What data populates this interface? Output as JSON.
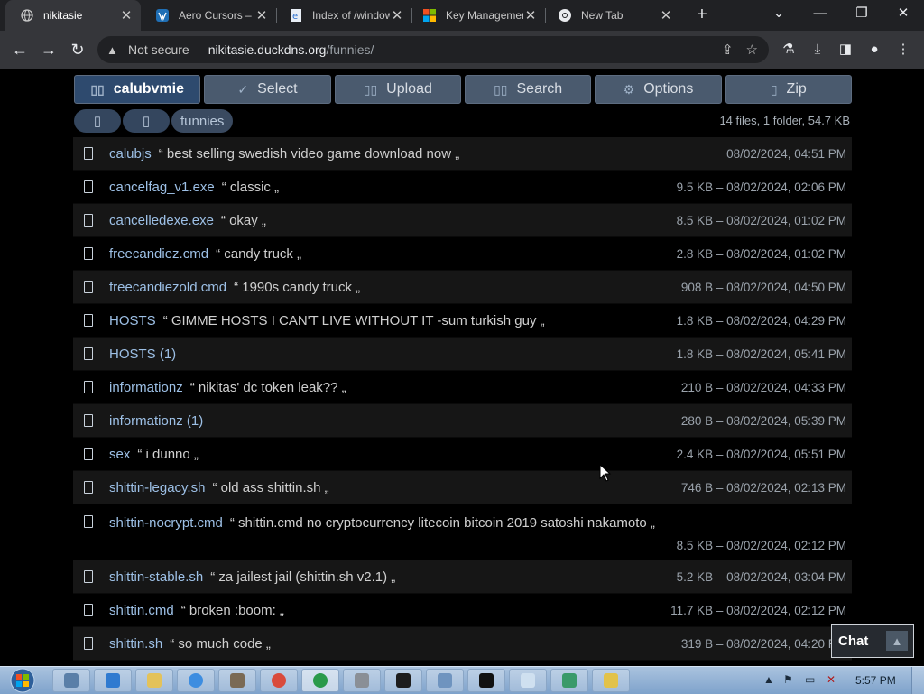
{
  "browser": {
    "tabs": [
      {
        "title": "nikitasie",
        "active": true
      },
      {
        "title": "Aero Cursors – W",
        "active": false
      },
      {
        "title": "Index of /window",
        "active": false
      },
      {
        "title": "Key Managemen",
        "active": false
      },
      {
        "title": "New Tab",
        "active": false
      }
    ],
    "address": {
      "security": "Not secure",
      "host": "nikitasie.duckdns.org",
      "path": "/funnies/"
    }
  },
  "toolbar": {
    "user": "calubvmie",
    "select": "Select",
    "upload": "Upload",
    "search": "Search",
    "options": "Options",
    "zip": "Zip"
  },
  "breadcrumb": {
    "folder": "funnies",
    "summary": "14 files, 1 folder, 54.7 KB"
  },
  "files": [
    {
      "name": "calubjs",
      "desc": "“ best selling swedish video game download now „",
      "meta": "08/02/2024, 04:51 PM"
    },
    {
      "name": "cancelfag_v1.exe",
      "desc": "“ classic „",
      "meta": "9.5 KB – 08/02/2024, 02:06 PM"
    },
    {
      "name": "cancelledexe.exe",
      "desc": "“ okay „",
      "meta": "8.5 KB – 08/02/2024, 01:02 PM"
    },
    {
      "name": "freecandiez.cmd",
      "desc": "“ candy truck „",
      "meta": "2.8 KB – 08/02/2024, 01:02 PM"
    },
    {
      "name": "freecandiezold.cmd",
      "desc": "“ 1990s candy truck „",
      "meta": "908 B – 08/02/2024, 04:50 PM"
    },
    {
      "name": "HOSTS",
      "desc": "“ GIMME HOSTS I CAN'T LIVE WITHOUT IT -sum turkish guy „",
      "meta": "1.8 KB – 08/02/2024, 04:29 PM"
    },
    {
      "name": "HOSTS (1)",
      "desc": "",
      "meta": "1.8 KB – 08/02/2024, 05:41 PM"
    },
    {
      "name": "informationz",
      "desc": "“ nikitas' dc token leak?? „",
      "meta": "210 B – 08/02/2024, 04:33 PM"
    },
    {
      "name": "informationz (1)",
      "desc": "",
      "meta": "280 B – 08/02/2024, 05:39 PM"
    },
    {
      "name": "sex",
      "desc": "“ i dunno „",
      "meta": "2.4 KB – 08/02/2024, 05:51 PM"
    },
    {
      "name": "shittin-legacy.sh",
      "desc": "“ old ass shittin.sh „",
      "meta": "746 B – 08/02/2024, 02:13 PM"
    },
    {
      "name": "shittin-nocrypt.cmd",
      "desc": "“ shittin.cmd no cryptocurrency litecoin bitcoin 2019 satoshi nakamoto „",
      "meta": "8.5 KB – 08/02/2024, 02:12 PM"
    },
    {
      "name": "shittin-stable.sh",
      "desc": "“ za jailest jail (shittin.sh v2.1) „",
      "meta": "5.2 KB – 08/02/2024, 03:04 PM"
    },
    {
      "name": "shittin.cmd",
      "desc": "“ broken :boom: „",
      "meta": "11.7 KB – 08/02/2024, 02:12 PM"
    },
    {
      "name": "shittin.sh",
      "desc": "“ so much code „",
      "meta": "319 B – 08/02/2024, 04:20 PM"
    }
  ],
  "chat": {
    "label": "Chat"
  },
  "taskbar": {
    "clock": "5:57 PM"
  }
}
